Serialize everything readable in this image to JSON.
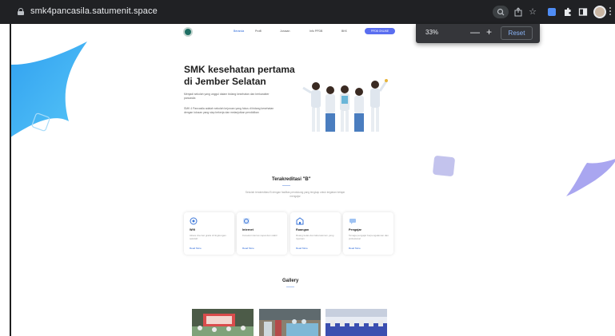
{
  "browser": {
    "url": "smk4pancasila.satumenit.space",
    "icons": [
      "lock-icon",
      "zoom-icon",
      "share-icon",
      "star-icon",
      "extension-icon",
      "puzzle-icon",
      "sidepanel-icon",
      "profile-avatar",
      "menu-icon"
    ]
  },
  "zoom_popup": {
    "percent": "33%",
    "minus": "—",
    "plus": "+",
    "reset": "Reset"
  },
  "nav": {
    "items": [
      "Beranda",
      "Profil",
      "Jurusan",
      "Info PPDB",
      "BKK"
    ],
    "button": "PPDB ONLINE"
  },
  "hero": {
    "title": "SMK kesehatan pertama di Jember Selatan",
    "paragraph1": "Menjadi sekolah yang unggul dalam bidang kesehatan dan berkarakter pancasila",
    "paragraph2": "SMK 4 Pancasila adalah sekolah kejuruan yang fokus di bidang kesehatan dengan lulusan yang siap bekerja dan melanjutkan pendidikan"
  },
  "accreditation": {
    "title": "Terakreditasi \"B\"",
    "description": "Sekolah terakreditasi B dengan fasilitas pendukung yang lengkap untuk kegiatan belajar mengajar",
    "cards": [
      {
        "title": "Wifi",
        "desc": "Akses internet gratis di lingkungan sekolah",
        "link": "Read More"
      },
      {
        "title": "Internet",
        "desc": "Koneksi internet cepat dan stabil",
        "link": "Read More"
      },
      {
        "title": "Ruangan",
        "desc": "Ruang kelas dan laboratorium yang nyaman",
        "link": "Read More"
      },
      {
        "title": "Pengajar",
        "desc": "Tenaga pengajar berpengalaman dan profesional",
        "link": "Read More"
      }
    ]
  },
  "gallery": {
    "title": "Gallery"
  },
  "colors": {
    "chrome": "#202124",
    "accent": "#5a6ef0",
    "link": "#2d6ad9",
    "blob": "#3aaef5"
  }
}
